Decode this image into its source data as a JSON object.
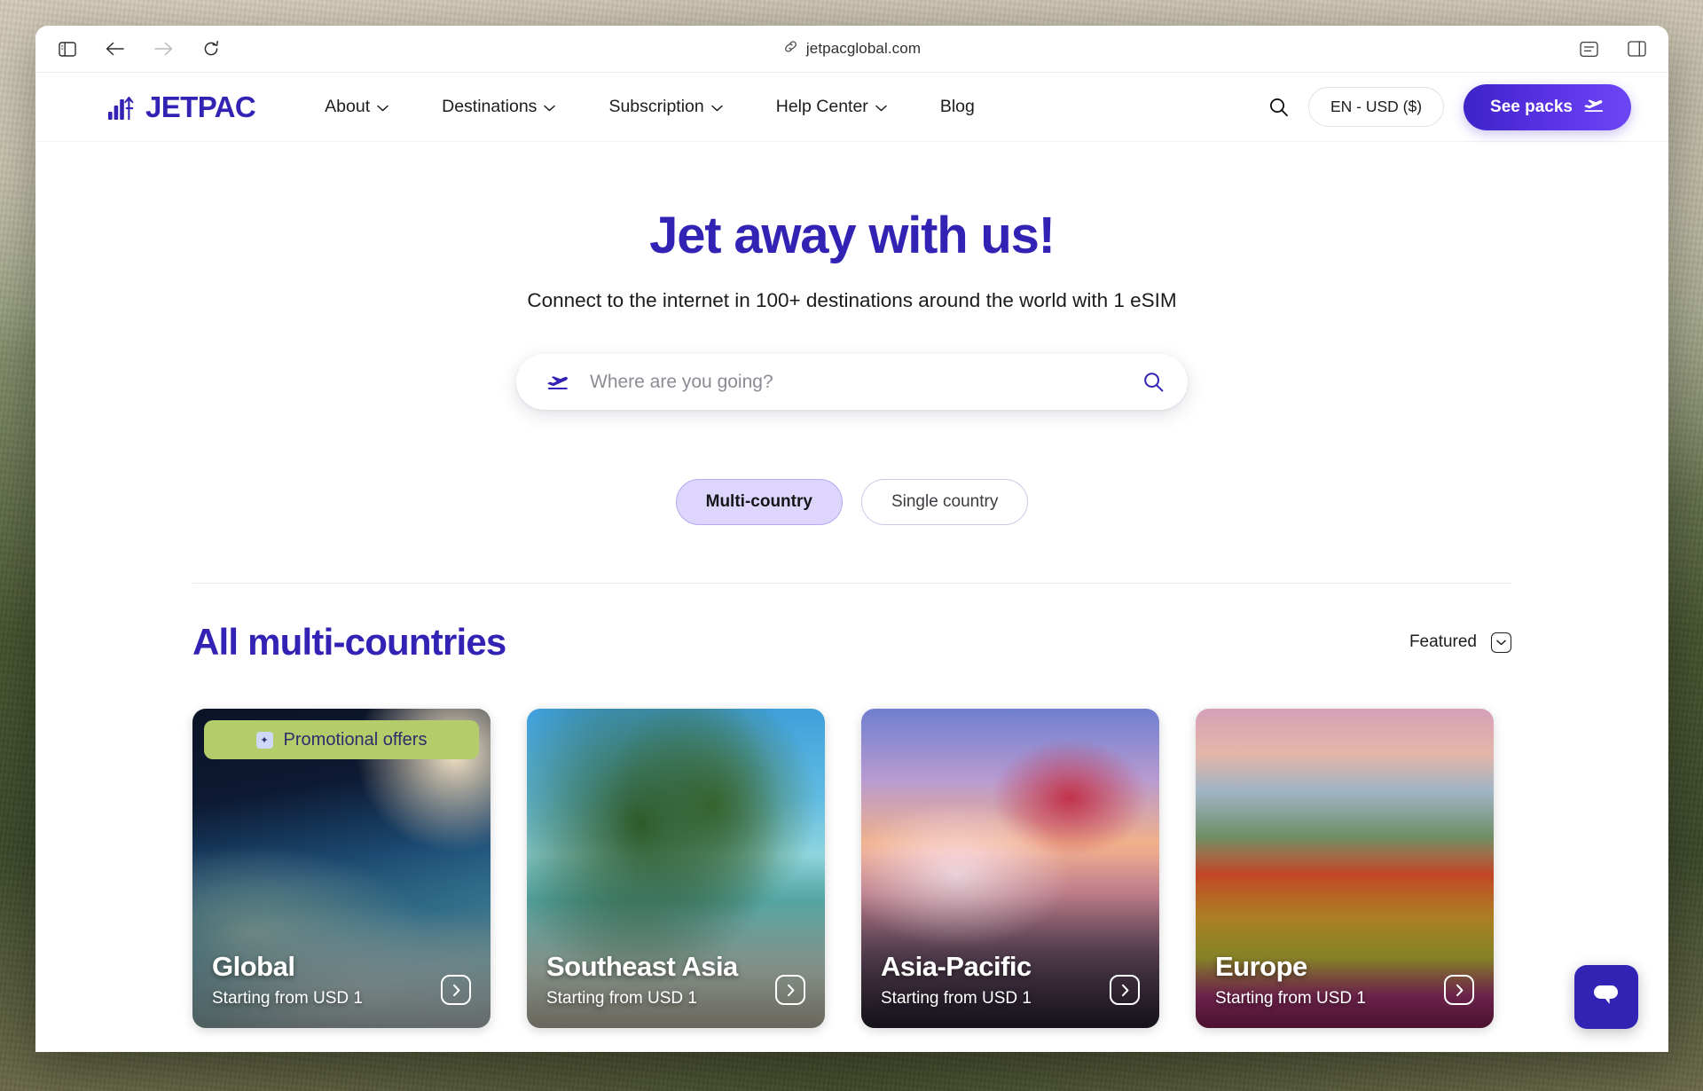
{
  "browser": {
    "url": "jetpacglobal.com",
    "icons": {
      "sidebar": "sidebar-toggle-icon",
      "back": "back-arrow-icon",
      "forward": "forward-arrow-icon",
      "reload": "reload-icon",
      "link": "link-icon",
      "reader": "reader-view-icon",
      "panel": "split-view-icon"
    }
  },
  "header": {
    "logo_text": "JETPAC",
    "nav": [
      {
        "label": "About",
        "has_dropdown": true
      },
      {
        "label": "Destinations",
        "has_dropdown": true
      },
      {
        "label": "Subscription",
        "has_dropdown": true
      },
      {
        "label": "Help Center",
        "has_dropdown": true
      },
      {
        "label": "Blog",
        "has_dropdown": false
      }
    ],
    "search_icon": "search-icon",
    "language_currency": "EN - USD ($)",
    "cta_label": "See packs"
  },
  "hero": {
    "title": "Jet away with us!",
    "subtitle": "Connect to the internet in 100+ destinations around the world with 1 eSIM",
    "search_placeholder": "Where are you going?",
    "search_value": ""
  },
  "filters": {
    "options": [
      {
        "label": "Multi-country",
        "active": true
      },
      {
        "label": "Single country",
        "active": false
      }
    ]
  },
  "section": {
    "title": "All multi-countries",
    "sort_label": "Featured"
  },
  "cards": [
    {
      "title": "Global",
      "price": "Starting from USD 1",
      "badge": "Promotional offers",
      "art": "art-global"
    },
    {
      "title": "Southeast Asia",
      "price": "Starting from USD 1",
      "badge": null,
      "art": "art-sea"
    },
    {
      "title": "Asia-Pacific",
      "price": "Starting from USD 1",
      "badge": null,
      "art": "art-asia"
    },
    {
      "title": "Europe",
      "price": "Starting from USD 1",
      "badge": null,
      "art": "art-europe"
    }
  ],
  "chat": {
    "icon": "chat-bubble-icon"
  },
  "colors": {
    "brand_purple": "#3323b5",
    "cta_gradient_start": "#3d23c8",
    "cta_gradient_end": "#6d46f5",
    "active_pill": "#ddd5fb",
    "promo_green": "#b5cc6a"
  }
}
